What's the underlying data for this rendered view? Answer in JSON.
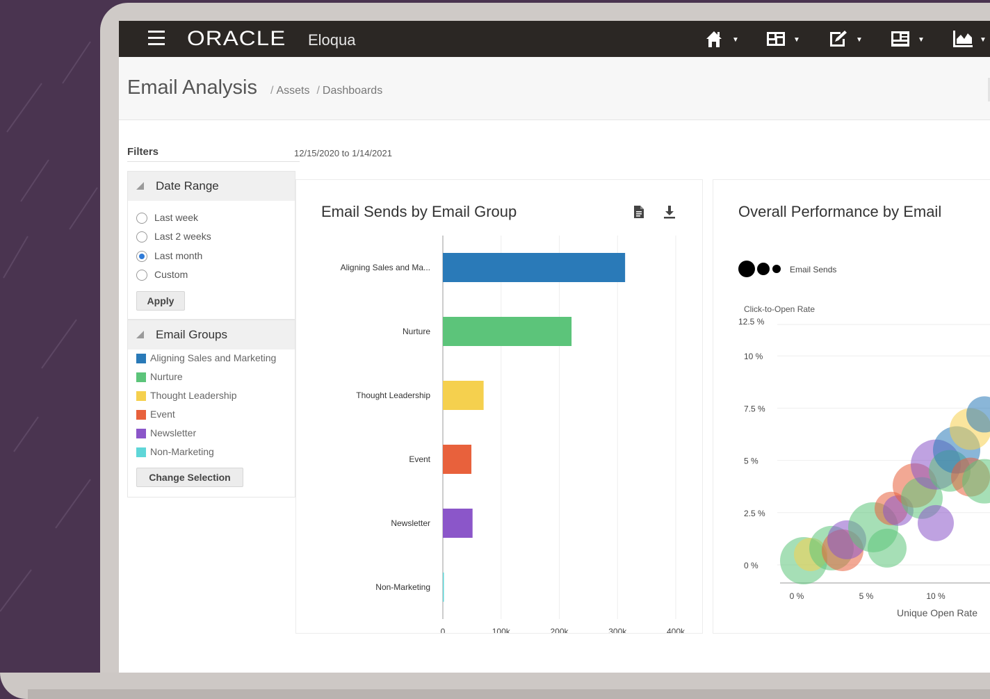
{
  "app": {
    "brand": "ORACLE",
    "product": "Eloqua"
  },
  "nav_icons": [
    {
      "name": "home-icon"
    },
    {
      "name": "dashboard-icon"
    },
    {
      "name": "edit-icon"
    },
    {
      "name": "contacts-icon"
    },
    {
      "name": "analytics-icon"
    }
  ],
  "header": {
    "title": "Email Analysis",
    "breadcrumbs": [
      "Assets",
      "Dashboards"
    ],
    "separator": "/"
  },
  "filters": {
    "label": "Filters",
    "date_text": "12/15/2020 to 1/14/2021",
    "date_range": {
      "title": "Date Range",
      "options": [
        "Last week",
        "Last 2 weeks",
        "Last month",
        "Custom"
      ],
      "selected": "Last month",
      "apply_label": "Apply"
    },
    "email_groups": {
      "title": "Email Groups",
      "items": [
        {
          "label": "Aligning Sales and Marketing",
          "color": "#2a7ab8"
        },
        {
          "label": "Nurture",
          "color": "#5cc47a"
        },
        {
          "label": "Thought Leadership",
          "color": "#f5d04e"
        },
        {
          "label": "Event",
          "color": "#e8613c"
        },
        {
          "label": "Newsletter",
          "color": "#8b56c9"
        },
        {
          "label": "Non-Marketing",
          "color": "#5fd6d8"
        }
      ],
      "change_label": "Change Selection"
    }
  },
  "chart_data": [
    {
      "type": "bar",
      "orientation": "horizontal",
      "title": "Email Sends by Email Group",
      "categories": [
        "Aligning Sales and Ma...",
        "Nurture",
        "Thought Leadership",
        "Event",
        "Newsletter",
        "Non-Marketing"
      ],
      "values": [
        313000,
        221000,
        70000,
        49000,
        51000,
        1000
      ],
      "colors": [
        "#2a7ab8",
        "#5cc47a",
        "#f5d04e",
        "#e8613c",
        "#8b56c9",
        "#5fd6d8"
      ],
      "xticks": [
        "0",
        "100k",
        "200k",
        "300k",
        "400k"
      ],
      "xlim": [
        0,
        400000
      ],
      "grid": true
    },
    {
      "type": "scatter",
      "subtype": "bubble",
      "title": "Overall Performance by Email",
      "legend": "Email Sends",
      "ylabel": "Click-to-Open Rate",
      "xlabel": "Unique Open Rate",
      "yticks": [
        "12.5 %",
        "10 %",
        "7.5 %",
        "5 %",
        "2.5 %",
        "0 %"
      ],
      "xticks": [
        "0 %",
        "5 %",
        "10 %"
      ],
      "ylim": [
        0,
        12.5
      ],
      "points": [
        {
          "x": 0.5,
          "y": 0.2,
          "r": 34,
          "color": "#5cc47a"
        },
        {
          "x": 1.0,
          "y": 0.5,
          "r": 24,
          "color": "#f5d04e"
        },
        {
          "x": 2.5,
          "y": 0.8,
          "r": 32,
          "color": "#5cc47a"
        },
        {
          "x": 3.3,
          "y": 0.7,
          "r": 30,
          "color": "#e8613c"
        },
        {
          "x": 3.6,
          "y": 1.2,
          "r": 28,
          "color": "#8b56c9"
        },
        {
          "x": 5.5,
          "y": 1.8,
          "r": 36,
          "color": "#5cc47a"
        },
        {
          "x": 6.5,
          "y": 0.8,
          "r": 28,
          "color": "#5cc47a"
        },
        {
          "x": 6.8,
          "y": 2.7,
          "r": 24,
          "color": "#e8613c"
        },
        {
          "x": 7.3,
          "y": 2.6,
          "r": 22,
          "color": "#8b56c9"
        },
        {
          "x": 8.5,
          "y": 3.8,
          "r": 32,
          "color": "#e8613c"
        },
        {
          "x": 9.0,
          "y": 3.2,
          "r": 30,
          "color": "#5cc47a"
        },
        {
          "x": 10.0,
          "y": 4.8,
          "r": 36,
          "color": "#8b56c9"
        },
        {
          "x": 10.0,
          "y": 2.0,
          "r": 26,
          "color": "#8b56c9"
        },
        {
          "x": 11.0,
          "y": 4.5,
          "r": 30,
          "color": "#5cc47a"
        },
        {
          "x": 11.5,
          "y": 5.5,
          "r": 34,
          "color": "#2a7ab8"
        },
        {
          "x": 12.5,
          "y": 4.2,
          "r": 28,
          "color": "#e8613c"
        },
        {
          "x": 12.5,
          "y": 6.5,
          "r": 30,
          "color": "#f5d04e"
        },
        {
          "x": 13.5,
          "y": 7.2,
          "r": 26,
          "color": "#2a7ab8"
        },
        {
          "x": 13.5,
          "y": 4.0,
          "r": 32,
          "color": "#5cc47a"
        }
      ]
    }
  ]
}
